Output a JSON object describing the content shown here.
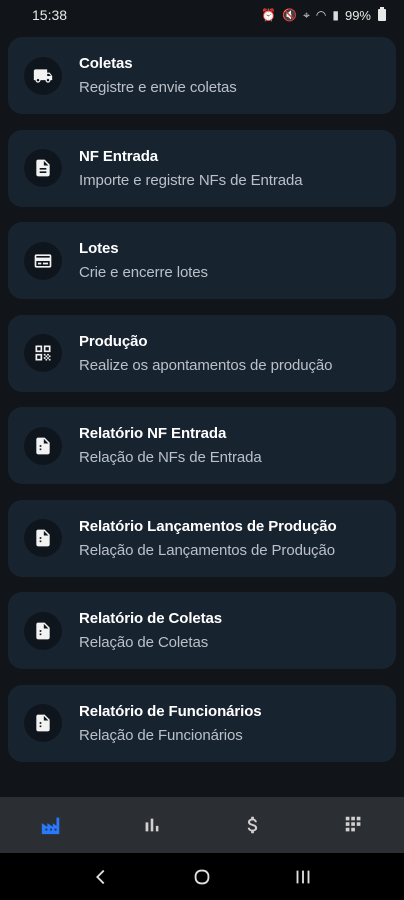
{
  "status_bar": {
    "time": "15:38",
    "battery": "99%",
    "icons": [
      "alarm-icon",
      "mute-icon",
      "location-icon",
      "wifi-icon",
      "signal-icon",
      "battery-icon"
    ]
  },
  "menu": {
    "items": [
      {
        "title": "Coletas",
        "subtitle": "Registre e envie coletas",
        "icon": "truck-icon"
      },
      {
        "title": "NF Entrada",
        "subtitle": "Importe e registre NFs de Entrada",
        "icon": "document-icon"
      },
      {
        "title": "Lotes",
        "subtitle": "Crie e encerre lotes",
        "icon": "card-icon"
      },
      {
        "title": "Produção",
        "subtitle": "Realize os apontamentos de produção",
        "icon": "qr-code-icon"
      },
      {
        "title": "Relatório NF Entrada",
        "subtitle": "Relação de NFs de Entrada",
        "icon": "report-icon"
      },
      {
        "title": "Relatório Lançamentos de Produção",
        "subtitle": "Relação de Lançamentos de Produção",
        "icon": "report-icon"
      },
      {
        "title": "Relatório de Coletas",
        "subtitle": "Relação de Coletas",
        "icon": "report-icon"
      },
      {
        "title": "Relatório de Funcionários",
        "subtitle": "Relação de Funcionários",
        "icon": "report-icon"
      }
    ]
  },
  "bottom_nav": {
    "items": [
      {
        "icon": "factory-icon",
        "active": true
      },
      {
        "icon": "bar-chart-icon",
        "active": false
      },
      {
        "icon": "dollar-icon",
        "active": false
      },
      {
        "icon": "pallet-icon",
        "active": false
      }
    ],
    "active_color": "#2979ff",
    "inactive_color": "#d0d0d0"
  },
  "colors": {
    "background": "#111418",
    "card": "#182330",
    "icon_circle": "#0f151c",
    "subtitle": "#b9c0c8",
    "nav_bar": "#2b2e33"
  }
}
